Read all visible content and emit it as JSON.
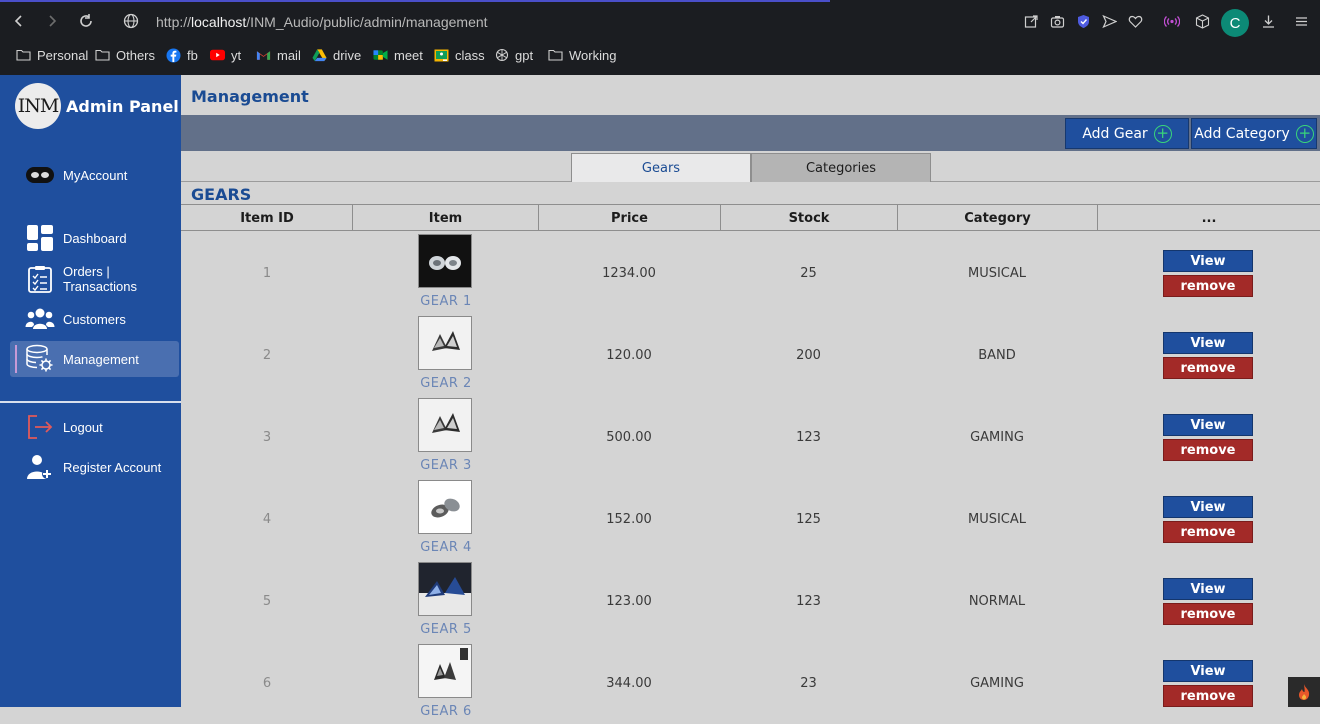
{
  "browser": {
    "url_prefix": "http://",
    "url_host": "localhost",
    "url_path": "/INM_Audio/public/admin/management",
    "profile_initial": "C",
    "bookmarks": [
      {
        "label": "Personal",
        "icon": "folder-icon"
      },
      {
        "label": "Others",
        "icon": "folder-icon"
      },
      {
        "label": "fb",
        "icon": "facebook-icon"
      },
      {
        "label": "yt",
        "icon": "youtube-icon"
      },
      {
        "label": "mail",
        "icon": "gmail-icon"
      },
      {
        "label": "drive",
        "icon": "drive-icon"
      },
      {
        "label": "meet",
        "icon": "meet-icon"
      },
      {
        "label": "class",
        "icon": "classroom-icon"
      },
      {
        "label": "gpt",
        "icon": "gpt-icon"
      },
      {
        "label": "Working",
        "icon": "folder-icon"
      }
    ]
  },
  "sidebar": {
    "logo_text": "INM",
    "title": "Admin Panel",
    "items": [
      {
        "label": "MyAccount",
        "icon": "account-icon"
      },
      {
        "label": "Dashboard",
        "icon": "dashboard-icon"
      },
      {
        "label": "Orders | Transactions",
        "icon": "orders-icon"
      },
      {
        "label": "Customers",
        "icon": "customers-icon"
      },
      {
        "label": "Management",
        "icon": "management-icon",
        "active": true
      },
      {
        "label": "Logout",
        "icon": "logout-icon"
      },
      {
        "label": "Register Account",
        "icon": "register-icon"
      }
    ]
  },
  "main": {
    "page_title": "Management",
    "toolbar": {
      "add_gear": "Add Gear",
      "add_category": "Add Category"
    },
    "tabs": [
      {
        "label": "Gears",
        "active": true
      },
      {
        "label": "Categories",
        "active": false
      }
    ],
    "section_title": "GEARS",
    "table": {
      "columns": [
        "Item ID",
        "Item",
        "Price",
        "Stock",
        "Category",
        "..."
      ],
      "view_label": "View",
      "remove_label": "remove",
      "rows": [
        {
          "id": "1",
          "name": "GEAR 1",
          "price": "1234.00",
          "stock": "25",
          "category": "MUSICAL"
        },
        {
          "id": "2",
          "name": "GEAR 2",
          "price": "120.00",
          "stock": "200",
          "category": "BAND"
        },
        {
          "id": "3",
          "name": "GEAR 3",
          "price": "500.00",
          "stock": "123",
          "category": "GAMING"
        },
        {
          "id": "4",
          "name": "GEAR 4",
          "price": "152.00",
          "stock": "125",
          "category": "MUSICAL"
        },
        {
          "id": "5",
          "name": "GEAR 5",
          "price": "123.00",
          "stock": "123",
          "category": "NORMAL"
        },
        {
          "id": "6",
          "name": "GEAR 6",
          "price": "344.00",
          "stock": "23",
          "category": "GAMING"
        }
      ]
    }
  },
  "colors": {
    "sidebar": "#1f4f9e",
    "accent_blue": "#1a4b93",
    "remove_red": "#a32a28",
    "toolbar": "#627089"
  }
}
